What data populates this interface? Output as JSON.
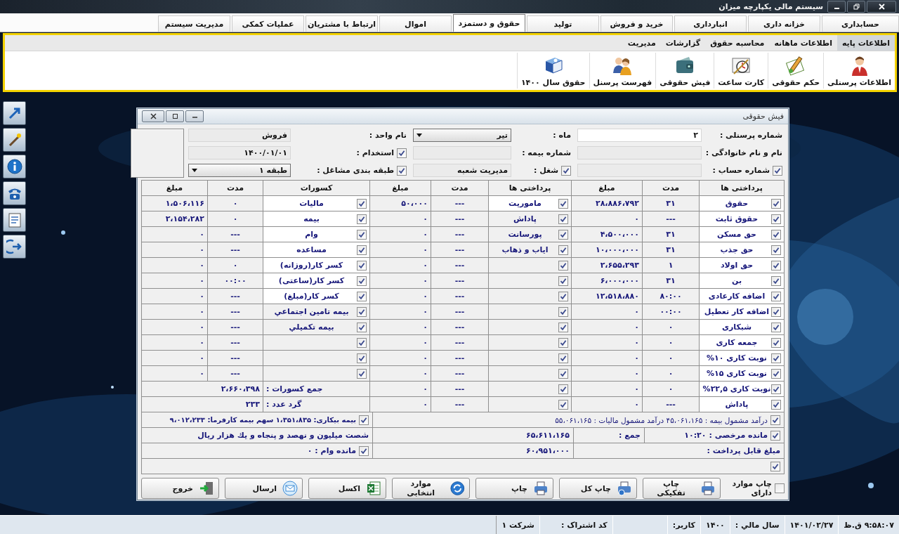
{
  "window": {
    "title": "سیستم مالی یکپارچه میزان"
  },
  "menu": [
    {
      "label": "حسابداری",
      "selected": false
    },
    {
      "label": "خزانه داری",
      "selected": false
    },
    {
      "label": "انبارداری",
      "selected": false
    },
    {
      "label": "خرید و فروش",
      "selected": false
    },
    {
      "label": "تولید",
      "selected": false
    },
    {
      "label": "حقوق و دستمزد",
      "selected": true
    },
    {
      "label": "اموال",
      "selected": false
    },
    {
      "label": "ارتباط با مشتریان",
      "selected": false
    },
    {
      "label": "عملیات کمکی",
      "selected": false
    },
    {
      "label": "مدیریت سیستم",
      "selected": false
    }
  ],
  "ribbon": {
    "tabs": [
      {
        "label": "اطلاعات پایه",
        "selected": true
      },
      {
        "label": "اطلاعات ماهانه",
        "selected": false
      },
      {
        "label": "محاسبه حقوق",
        "selected": false
      },
      {
        "label": "گزارشات",
        "selected": false
      },
      {
        "label": "مدیریت",
        "selected": false
      }
    ],
    "buttons": [
      {
        "label": "اطلاعات پرسنلی"
      },
      {
        "label": "حکم حقوقی"
      },
      {
        "label": "کارت ساعت"
      },
      {
        "label": "فیش حقوقی"
      },
      {
        "label": "فهرست پرسنل"
      },
      {
        "label": "حقوق سال ۱۴۰۰"
      }
    ]
  },
  "payslip": {
    "title": "فیش حقوقی",
    "header": [
      {
        "fields": [
          {
            "kind": "text",
            "label": "شماره پرسنلی :",
            "value": "۲"
          },
          {
            "kind": "select",
            "label": "ماه :",
            "value": "تیر"
          },
          {
            "kind": "text",
            "label": "نام واحد :",
            "value": "فروش"
          }
        ]
      },
      {
        "fields": [
          {
            "kind": "text",
            "label": "نام و نام خانوادگی :"
          },
          {
            "kind": "text",
            "label": "شماره بیمه :"
          },
          {
            "kind": "text",
            "label": "استخدام :",
            "checked": true,
            "value": "۱۴۰۰/۰۱/۰۱"
          }
        ]
      },
      {
        "fields": [
          {
            "kind": "text",
            "label": "شماره حساب :",
            "checked": true
          },
          {
            "kind": "text",
            "label": "شغل :",
            "checked": true,
            "value": "مدیریت شعبه"
          },
          {
            "kind": "select",
            "label": "طبقه بندی مشاغل :",
            "checked": true,
            "value": "طبقه ۱"
          }
        ]
      }
    ],
    "groups": [
      {
        "headers": [
          "پرداختی ها",
          "مدت",
          "مبلغ"
        ],
        "rows": [
          {
            "checked": true,
            "editable": true,
            "name": "حقوق",
            "duration": "۳۱",
            "amount": "۲۸،۸۸۶،۷۹۲"
          },
          {
            "checked": true,
            "editable": true,
            "name": "حقوق ثابت",
            "duration": "---",
            "amount": "۰"
          },
          {
            "checked": true,
            "editable": true,
            "name": "حق مسکن",
            "duration": "۳۱",
            "amount": "۴،۵۰۰،۰۰۰"
          },
          {
            "checked": true,
            "editable": true,
            "name": "حق جذب",
            "duration": "۳۱",
            "amount": "۱۰،۰۰۰،۰۰۰"
          },
          {
            "checked": true,
            "editable": true,
            "name": "حق اولاد",
            "duration": "۱",
            "amount": "۲،۶۵۵،۲۹۳"
          },
          {
            "checked": true,
            "editable": true,
            "name": "بن",
            "duration": "۳۱",
            "amount": "۶،۰۰۰،۰۰۰"
          },
          {
            "checked": true,
            "editable": true,
            "name": "اضافه کارعادی",
            "duration": "۸۰:۰۰",
            "amount": "۱۲،۵۱۸،۸۸۰"
          },
          {
            "checked": true,
            "editable": true,
            "name": "اضافه کار تعطیل",
            "duration": "۰۰:۰۰",
            "amount": "۰"
          },
          {
            "checked": true,
            "editable": true,
            "name": "شبکاری",
            "duration": "۰",
            "amount": "۰"
          },
          {
            "checked": true,
            "editable": true,
            "name": "جمعه کاری",
            "duration": "۰",
            "amount": "۰"
          },
          {
            "checked": true,
            "editable": true,
            "name": "نوبت کاری ۱۰%",
            "duration": "۰",
            "amount": "۰"
          },
          {
            "checked": true,
            "editable": true,
            "name": "نوبت کاری ۱۵%",
            "duration": "۰",
            "amount": "۰"
          },
          {
            "checked": true,
            "editable": true,
            "name": "نوبت کاری ۲۲,۵%",
            "duration": "۰",
            "amount": "۰"
          },
          {
            "checked": true,
            "editable": true,
            "name": "پاداش",
            "duration": "---",
            "amount": "۰"
          }
        ]
      },
      {
        "headers": [
          "پرداختی ها",
          "مدت",
          "مبلغ"
        ],
        "rows": [
          {
            "checked": true,
            "editable": true,
            "name": "ماموریت",
            "duration": "---",
            "amount": "۵۰،۰۰۰"
          },
          {
            "checked": true,
            "editable": false,
            "name": "پاداش",
            "duration": "---",
            "amount": "۰"
          },
          {
            "checked": true,
            "editable": false,
            "name": "پورسانت",
            "duration": "---",
            "amount": "۰"
          },
          {
            "checked": true,
            "editable": false,
            "name": "ایاب و ذهاب",
            "duration": "---",
            "amount": "۰"
          },
          {
            "checked": true,
            "editable": false,
            "duration": "---",
            "amount": "۰"
          },
          {
            "checked": true,
            "editable": false,
            "duration": "---",
            "amount": "۰"
          },
          {
            "checked": true,
            "editable": false,
            "duration": "---",
            "amount": "۰"
          },
          {
            "checked": true,
            "editable": false,
            "duration": "---",
            "amount": "۰"
          },
          {
            "checked": true,
            "editable": false,
            "duration": "---",
            "amount": "۰"
          },
          {
            "checked": true,
            "editable": false,
            "duration": "---",
            "amount": "۰"
          },
          {
            "checked": true,
            "editable": false,
            "duration": "---",
            "amount": "۰"
          },
          {
            "checked": true,
            "editable": false,
            "duration": "---",
            "amount": "۰"
          },
          {
            "checked": true,
            "editable": false,
            "duration": "---",
            "amount": "۰"
          },
          {
            "checked": true,
            "editable": false,
            "duration": "---",
            "amount": "۰"
          }
        ]
      },
      {
        "headers": [
          "کسورات",
          "مدت",
          "مبلغ"
        ],
        "rows": [
          {
            "checked": true,
            "editable": true,
            "name": "مالیات",
            "duration": "۰",
            "amount": "۱،۵۰۶،۱۱۶"
          },
          {
            "checked": true,
            "editable": true,
            "name": "بیمه",
            "duration": "۰",
            "amount": "۲،۱۵۴،۲۸۲"
          },
          {
            "checked": true,
            "editable": true,
            "name": "وام",
            "duration": "---",
            "amount": "۰"
          },
          {
            "checked": true,
            "editable": true,
            "name": "مساعده",
            "duration": "---",
            "amount": "۰"
          },
          {
            "checked": true,
            "editable": true,
            "name": "کسر کار(روزانه)",
            "duration": "۰",
            "amount": "۰"
          },
          {
            "checked": true,
            "editable": true,
            "name": "کسر کار(ساعتی)",
            "duration": "۰۰:۰۰",
            "amount": "۰"
          },
          {
            "checked": true,
            "editable": true,
            "name": "کسر کار(مبلغ)",
            "duration": "---",
            "amount": "۰"
          },
          {
            "checked": true,
            "editable": false,
            "name": "بیمه تامین اجتماعي",
            "duration": "---",
            "amount": "۰"
          },
          {
            "checked": true,
            "editable": false,
            "name": "بیمه تکمیلي",
            "duration": "---",
            "amount": "۰"
          },
          {
            "checked": true,
            "editable": false,
            "duration": "---",
            "amount": "۰"
          },
          {
            "checked": true,
            "editable": false,
            "duration": "---",
            "amount": "۰"
          },
          {
            "checked": true,
            "editable": false,
            "duration": "---",
            "amount": "۰"
          }
        ],
        "totals": [
          {
            "label": "جمع کسورات :",
            "value": "۲،۶۶۰،۳۹۸"
          },
          {
            "label": "گرد عدد :",
            "value": "۲۳۳"
          }
        ]
      }
    ],
    "summary": {
      "taxable": {
        "checked": true,
        "text": "درآمد مشمول بیمه : ۴۵،۰۶۱،۱۶۵ درآمد مشمول مالیات : ۵۵،۰۶۱،۱۶۵"
      },
      "unemployment": {
        "checked": true,
        "text": "بیمه بیکاری: ۱،۳۵۱،۸۳۵ سهم بیمه کارفرما: ۹،۰۱۲،۲۳۳"
      },
      "leave": {
        "checked": true,
        "label": "مانده مرخصی :",
        "value": "۱۰:۲۰"
      },
      "total": {
        "label": "جمع :",
        "value": "۶۵،۶۱۱،۱۶۵"
      },
      "in_words": "شصت میلیون و نهصد و پنجاه و یك هزار ریال",
      "payable": {
        "label": "مبلغ قابل پرداخت :",
        "value": "۶۰،۹۵۱،۰۰۰"
      },
      "loan_balance": {
        "checked": true,
        "text": "مانده وام : ۰"
      },
      "extra": {
        "checked": true
      }
    },
    "print_option": {
      "label": "چاپ موارد دارای",
      "checked": false
    },
    "buttons": [
      {
        "label": "چاپ تفکیکی"
      },
      {
        "label": "چاپ کل"
      },
      {
        "label": "چاپ"
      },
      {
        "label": "موارد انتخابی"
      },
      {
        "label": "اکسل"
      },
      {
        "label": "ارسال"
      },
      {
        "label": "خروج"
      }
    ]
  },
  "status_bar": [
    {
      "kind": "text",
      "text": "۹:۵۸:۰۷ ق.ظ"
    },
    {
      "kind": "text",
      "text": "۱۴۰۱/۰۲/۲۷"
    },
    {
      "kind": "pair",
      "label": "سال مالي :",
      "value": "۱۴۰۰"
    },
    {
      "kind": "pair",
      "label": "کاربر:"
    },
    {
      "kind": "field",
      "label": "کد اشتراک :"
    },
    {
      "kind": "text",
      "text": "شرکت ۱"
    }
  ]
}
